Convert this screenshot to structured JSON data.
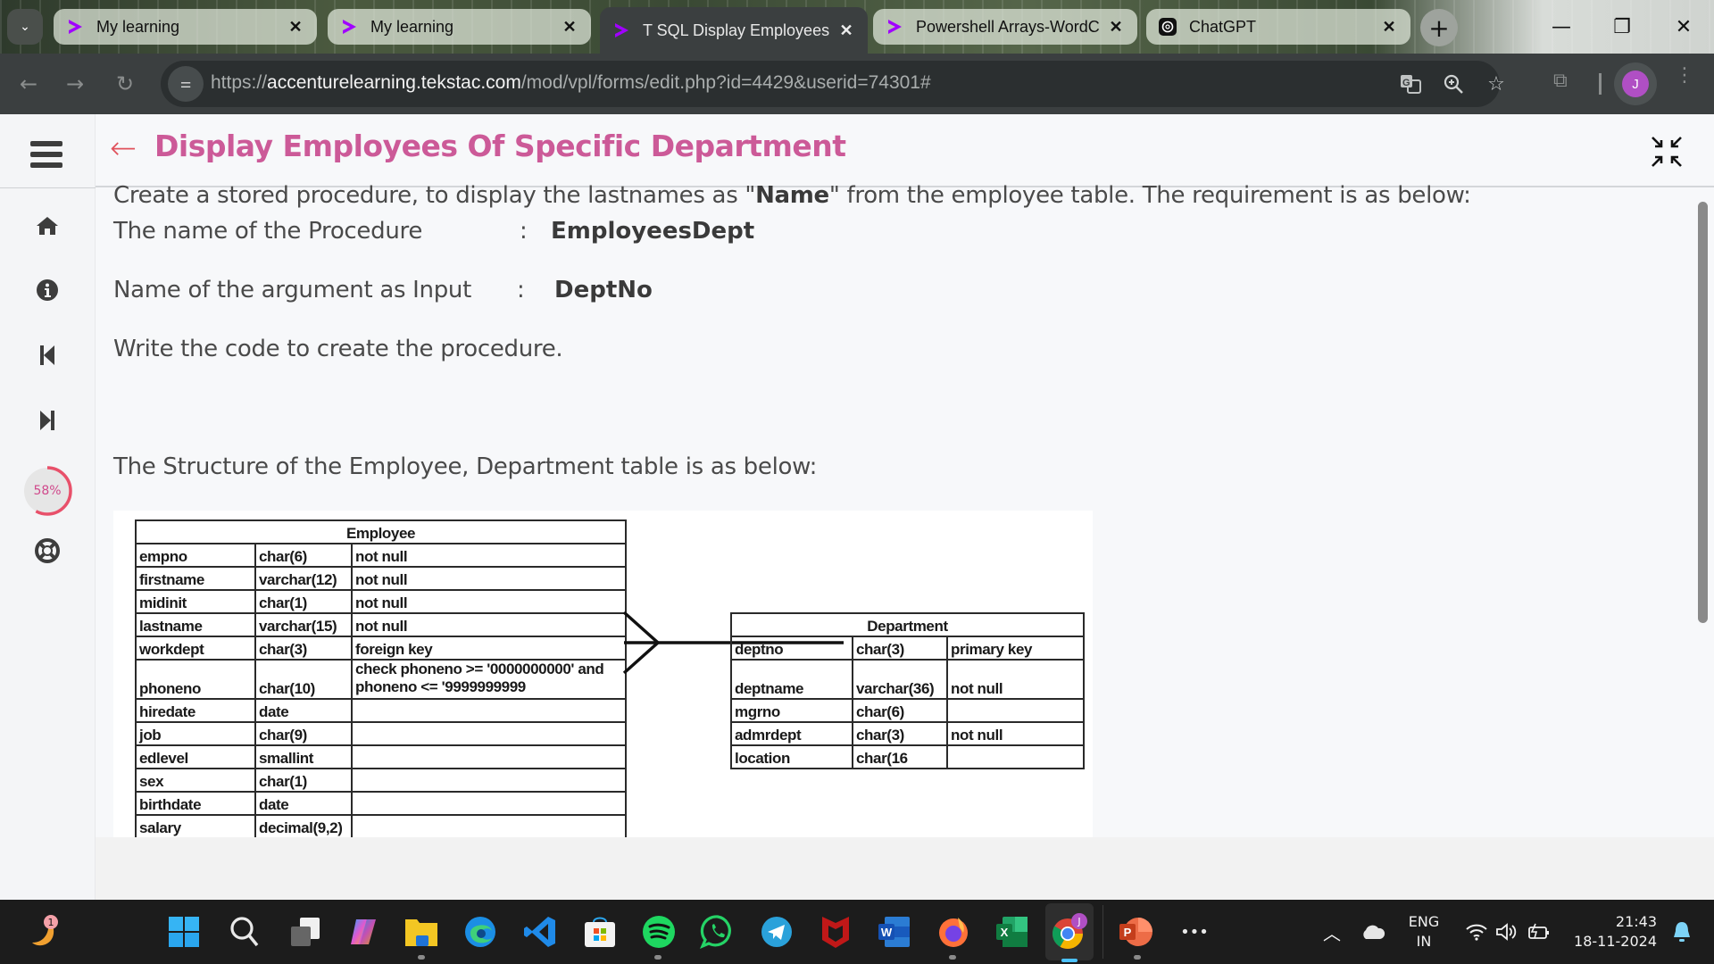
{
  "browser": {
    "tabs": [
      {
        "title": "My learning",
        "favicon": "accenture-icon",
        "active": false
      },
      {
        "title": "My learning",
        "favicon": "accenture-icon",
        "active": false
      },
      {
        "title": "T SQL Display Employees",
        "favicon": "accenture-icon",
        "active": true
      },
      {
        "title": "Powershell Arrays-WordC",
        "favicon": "accenture-icon",
        "active": false
      },
      {
        "title": "ChatGPT",
        "favicon": "chatgpt-icon",
        "active": false
      }
    ],
    "tab_close_glyph": "✕",
    "new_tab_glyph": "+",
    "window": {
      "minimize": "—",
      "restore": "❐",
      "close": "✕"
    },
    "url": {
      "scheme": "https://",
      "host": "accenturelearning.tekstac.com",
      "path": "/mod/vpl/forms/edit.php?id=4429&userid=74301#"
    },
    "profile_initial": "J",
    "accent_color": "#b04fc4"
  },
  "sidebar": {
    "items": [
      {
        "name": "home",
        "icon": "home-icon"
      },
      {
        "name": "info",
        "icon": "info-icon"
      },
      {
        "name": "previous",
        "icon": "skip-back-icon"
      },
      {
        "name": "next",
        "icon": "skip-forward-icon"
      },
      {
        "name": "help",
        "icon": "lifebuoy-icon"
      }
    ],
    "progress": {
      "percent": 58,
      "label": "58%",
      "color": "#e8506a"
    }
  },
  "header": {
    "title": "Display Employees Of Specific Department",
    "title_color": "#cc5a98"
  },
  "content": {
    "intro_before": "Create a stored procedure, to display the lastnames as \"",
    "intro_bold": "Name",
    "intro_after": "\" from the employee table. The requirement is as below:",
    "requirements": [
      {
        "label": "The name of the Procedure",
        "colon": ":",
        "value": "EmployeesDept"
      },
      {
        "label": "Name of the argument as Input",
        "colon": ":",
        "value": "DeptNo"
      }
    ],
    "instruction": "Write the code to create the procedure.",
    "structure_heading": "The Structure of the Employee, Department table is as below:"
  },
  "employee_table": {
    "title": "Employee",
    "rows": [
      [
        "empno",
        "char(6)",
        "not null"
      ],
      [
        "firstname",
        "varchar(12)",
        "not null"
      ],
      [
        "midinit",
        "char(1)",
        "not null"
      ],
      [
        "lastname",
        "varchar(15)",
        "not null"
      ],
      [
        "workdept",
        "char(3)",
        "foreign key"
      ],
      [
        "phoneno",
        "char(10)",
        "check phoneno >= '0000000000' and",
        "phoneno <= '9999999999"
      ],
      [
        "hiredate",
        "date",
        ""
      ],
      [
        "job",
        "char(9)",
        ""
      ],
      [
        "edlevel",
        "smallint",
        ""
      ],
      [
        "sex",
        "char(1)",
        ""
      ],
      [
        "birthdate",
        "date",
        ""
      ],
      [
        "salary",
        "decimal(9,2)",
        ""
      ]
    ]
  },
  "department_table": {
    "title": "Department",
    "rows": [
      [
        "deptno",
        "char(3)",
        "primary key"
      ],
      [
        "deptname",
        "varchar(36)",
        "not null"
      ],
      [
        "mgrno",
        "char(6)",
        ""
      ],
      [
        "admrdept",
        "char(3)",
        "not null"
      ],
      [
        "location",
        "char(16",
        ""
      ]
    ]
  },
  "taskbar": {
    "apps": [
      {
        "name": "start",
        "icon": "windows-start-icon"
      },
      {
        "name": "search",
        "icon": "search-icon"
      },
      {
        "name": "task-view",
        "icon": "task-view-icon"
      },
      {
        "name": "copilot",
        "icon": "copilot-icon"
      },
      {
        "name": "file-explorer",
        "icon": "folder-icon"
      },
      {
        "name": "edge",
        "icon": "edge-icon"
      },
      {
        "name": "vscode",
        "icon": "vscode-icon"
      },
      {
        "name": "store",
        "icon": "store-icon"
      },
      {
        "name": "spotify",
        "icon": "spotify-icon"
      },
      {
        "name": "whatsapp",
        "icon": "whatsapp-icon"
      },
      {
        "name": "telegram",
        "icon": "telegram-icon"
      },
      {
        "name": "mcafee",
        "icon": "mcafee-icon"
      },
      {
        "name": "word",
        "icon": "word-icon"
      },
      {
        "name": "firefox",
        "icon": "firefox-icon"
      },
      {
        "name": "excel",
        "icon": "excel-icon"
      },
      {
        "name": "chrome",
        "icon": "chrome-icon"
      },
      {
        "name": "powerpoint",
        "icon": "powerpoint-icon"
      }
    ],
    "widget_badge": "1",
    "chrome_badge": "J",
    "overflow": "•••",
    "tray": {
      "language_line1": "ENG",
      "language_line2": "IN",
      "time": "21:43",
      "date": "18-11-2024"
    }
  }
}
